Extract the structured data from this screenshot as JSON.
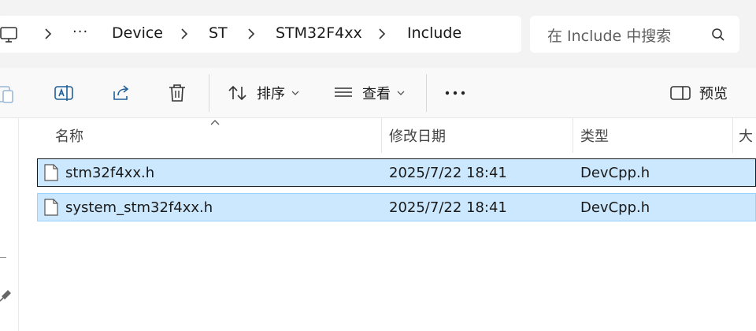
{
  "breadcrumb": {
    "more": "···",
    "items": [
      "Device",
      "ST",
      "STM32F4xx",
      "Include"
    ]
  },
  "search": {
    "placeholder": "在 Include 中搜索"
  },
  "toolbar": {
    "sort_label": "排序",
    "view_label": "查看",
    "more_label": "···",
    "preview_label": "预览"
  },
  "columns": {
    "name": "名称",
    "modified": "修改日期",
    "type": "类型",
    "size": "大"
  },
  "files": [
    {
      "name": "stm32f4xx.h",
      "modified": "2025/7/22 18:41",
      "type": "DevCpp.h"
    },
    {
      "name": "system_stm32f4xx.h",
      "modified": "2025/7/22 18:41",
      "type": "DevCpp.h"
    }
  ],
  "colors": {
    "selection": "#cce8ff",
    "selection_border": "#99d1ff",
    "accent": "#0067c0"
  }
}
